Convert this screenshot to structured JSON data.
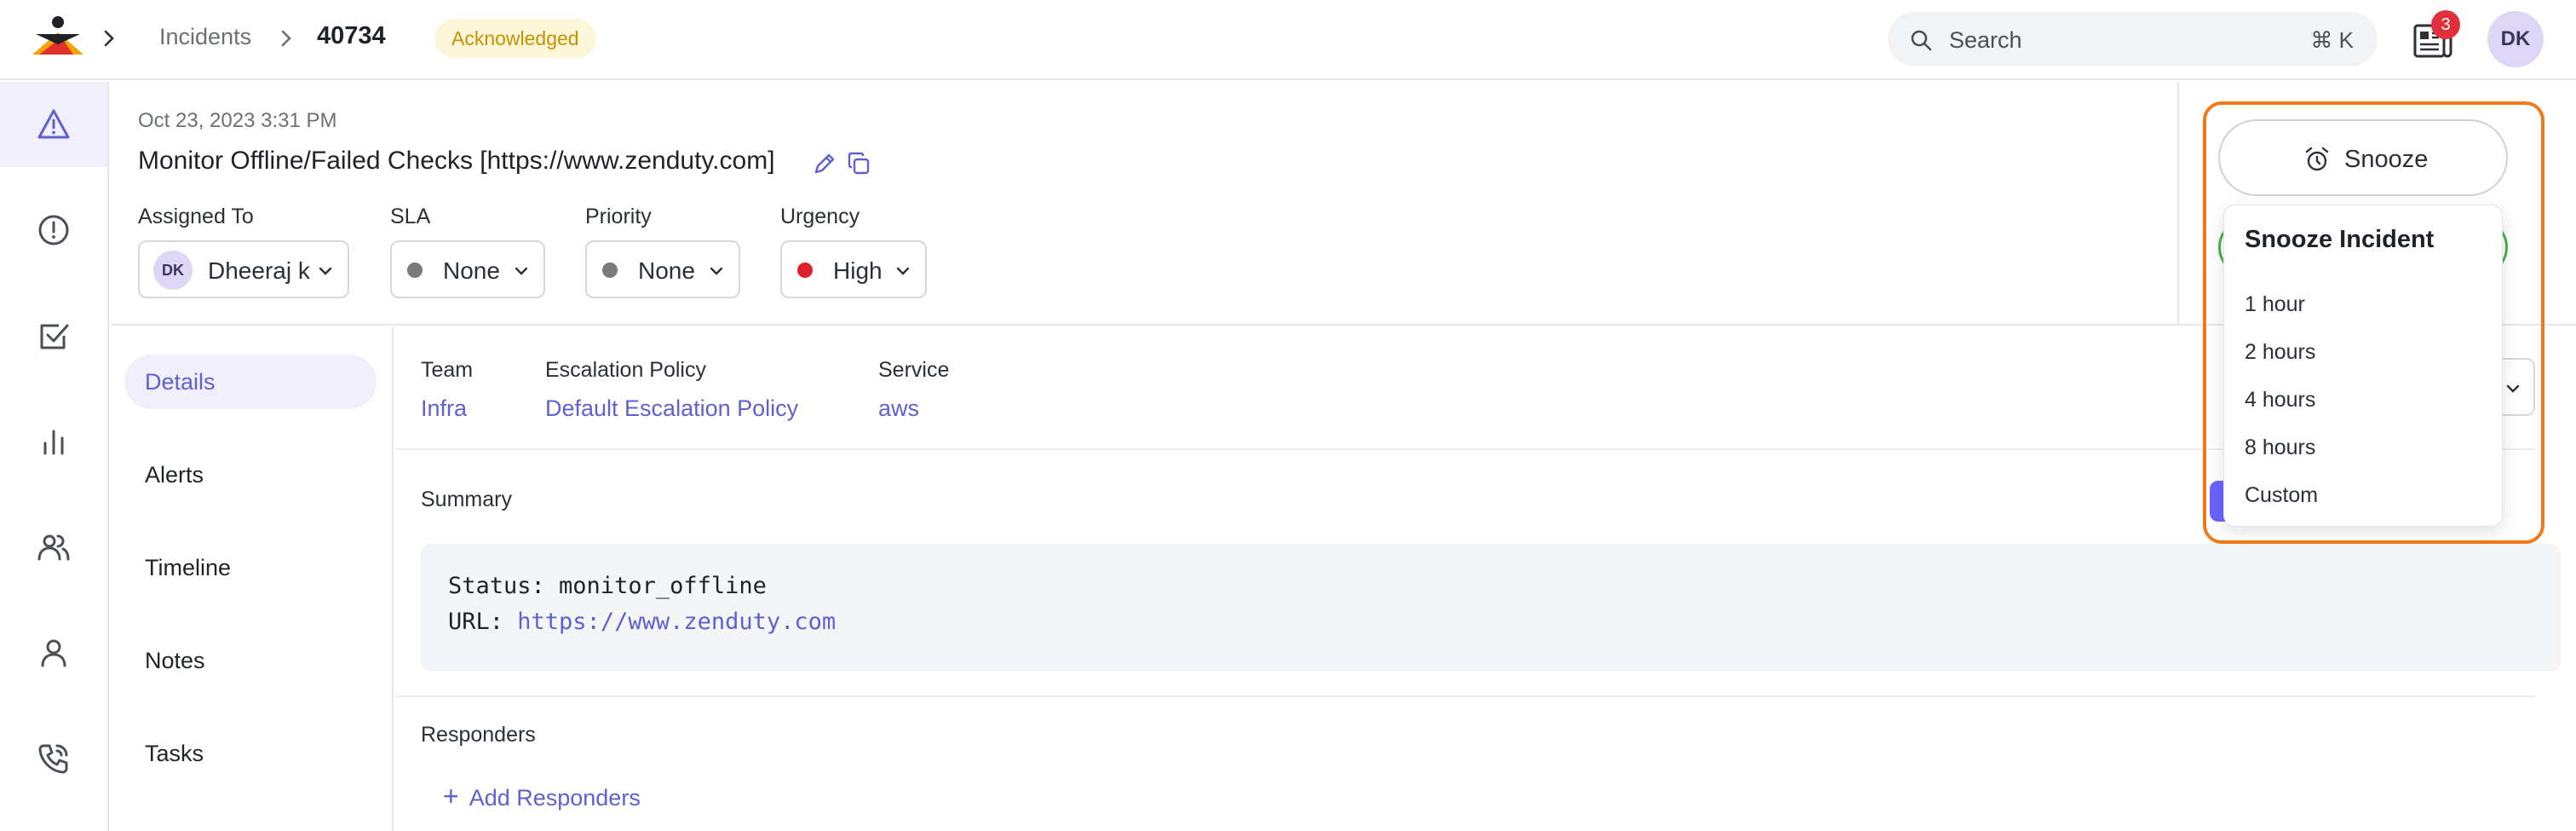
{
  "breadcrumb": {
    "section": "Incidents",
    "incident_id": "40734",
    "status": "Acknowledged"
  },
  "search": {
    "label": "Search",
    "shortcut": "⌘ K"
  },
  "notifications": {
    "count": "3"
  },
  "user": {
    "initials": "DK"
  },
  "rail": {
    "icons": [
      "warning-triangle-icon",
      "alert-circle-icon",
      "checkbox-icon",
      "bar-chart-icon",
      "users-icon",
      "user-icon",
      "phone-icon"
    ],
    "active_index": 0
  },
  "incident": {
    "date": "Oct 23, 2023 3:31 PM",
    "title": "Monitor Offline/Failed Checks [https://www.zenduty.com]"
  },
  "fields": {
    "assigned_to": {
      "label": "Assigned To",
      "initials": "DK",
      "value": "Dheeraj k"
    },
    "sla": {
      "label": "SLA",
      "value": "None",
      "dot_color": "#7a7a7a"
    },
    "priority": {
      "label": "Priority",
      "value": "None",
      "dot_color": "#7a7a7a"
    },
    "urgency": {
      "label": "Urgency",
      "value": "High",
      "dot_color": "#e0202c"
    }
  },
  "subnav": [
    "Details",
    "Alerts",
    "Timeline",
    "Notes",
    "Tasks"
  ],
  "meta": {
    "team": {
      "label": "Team",
      "value": "Infra"
    },
    "escalation": {
      "label": "Escalation Policy",
      "value": "Default Escalation Policy"
    },
    "service": {
      "label": "Service",
      "value": "aws"
    }
  },
  "summary": {
    "label": "Summary",
    "status_key": "Status: ",
    "status_value": "monitor_offline",
    "url_key": "URL: ",
    "url_value": "https://www.zenduty.com"
  },
  "responders": {
    "label": "Responders",
    "add_label": "Add Responders"
  },
  "snooze": {
    "button_label": "Snooze",
    "menu_title": "Snooze Incident",
    "options": [
      "1 hour",
      "2 hours",
      "4 hours",
      "8 hours",
      "Custom"
    ]
  },
  "colors": {
    "accent": "#6060d0",
    "highlight": "#f07a1a",
    "status_badge_bg": "#fdf6d8",
    "status_badge_text": "#c79100"
  }
}
